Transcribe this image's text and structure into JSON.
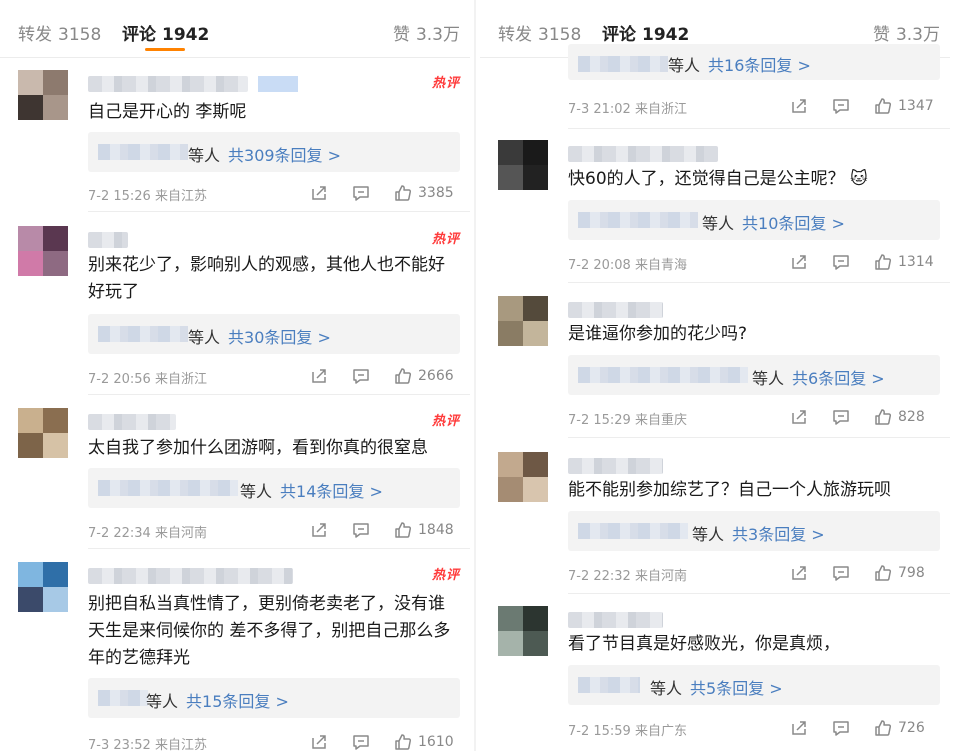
{
  "header": {
    "repost_label": "转发",
    "repost_count": "3158",
    "comment_label": "评论",
    "comment_count": "1942",
    "like_label": "赞",
    "like_count": "3.3万",
    "accent_color": "#ff8200"
  },
  "hot_label": "热评",
  "reply_who": "等人",
  "left": {
    "comments": [
      {
        "text": "自己是开心的 李斯呢",
        "reply_link": "共309条回复 >",
        "time": "7-2 15:26 来自江苏",
        "likes": "3385"
      },
      {
        "text": "别来花少了，影响别人的观感，其他人也不能好好玩了",
        "reply_link": "共30条回复 >",
        "time": "7-2 20:56 来自浙江",
        "likes": "2666"
      },
      {
        "text": "太自我了参加什么团游啊，看到你真的很窒息",
        "reply_link": "共14条回复 >",
        "time": "7-2 22:34 来自河南",
        "likes": "1848"
      },
      {
        "text": "别把自私当真性情了，更别倚老卖老了，没有谁天生是来伺候你的 差不多得了，别把自己那么多年的艺德拜光",
        "reply_link": "共15条回复 >",
        "time": "7-3 23:52 来自江苏",
        "likes": "1610"
      }
    ]
  },
  "right": {
    "partial": {
      "reply_link": "共16条回复 >",
      "time": "7-3 21:02 来自浙江",
      "likes": "1347"
    },
    "comments": [
      {
        "text": "快60的人了，还觉得自己是公主呢？",
        "emoji": "🐱",
        "reply_link": "共10条回复 >",
        "time": "7-2 20:08 来自青海",
        "likes": "1314"
      },
      {
        "text": "是谁逼你参加的花少吗?",
        "reply_link": "共6条回复 >",
        "time": "7-2 15:29 来自重庆",
        "likes": "828"
      },
      {
        "text": "能不能别参加综艺了？自己一个人旅游玩呗",
        "reply_link": "共3条回复 >",
        "time": "7-2 22:32 来自河南",
        "likes": "798"
      },
      {
        "text": "看了节目真是好感败光，你是真烦，",
        "reply_link": "共5条回复 >",
        "time": "7-2 15:59 来自广东",
        "likes": "726"
      }
    ]
  },
  "icons": {
    "repost": "repost-icon",
    "comment": "comment-icon",
    "like": "thumbs-up-icon"
  }
}
